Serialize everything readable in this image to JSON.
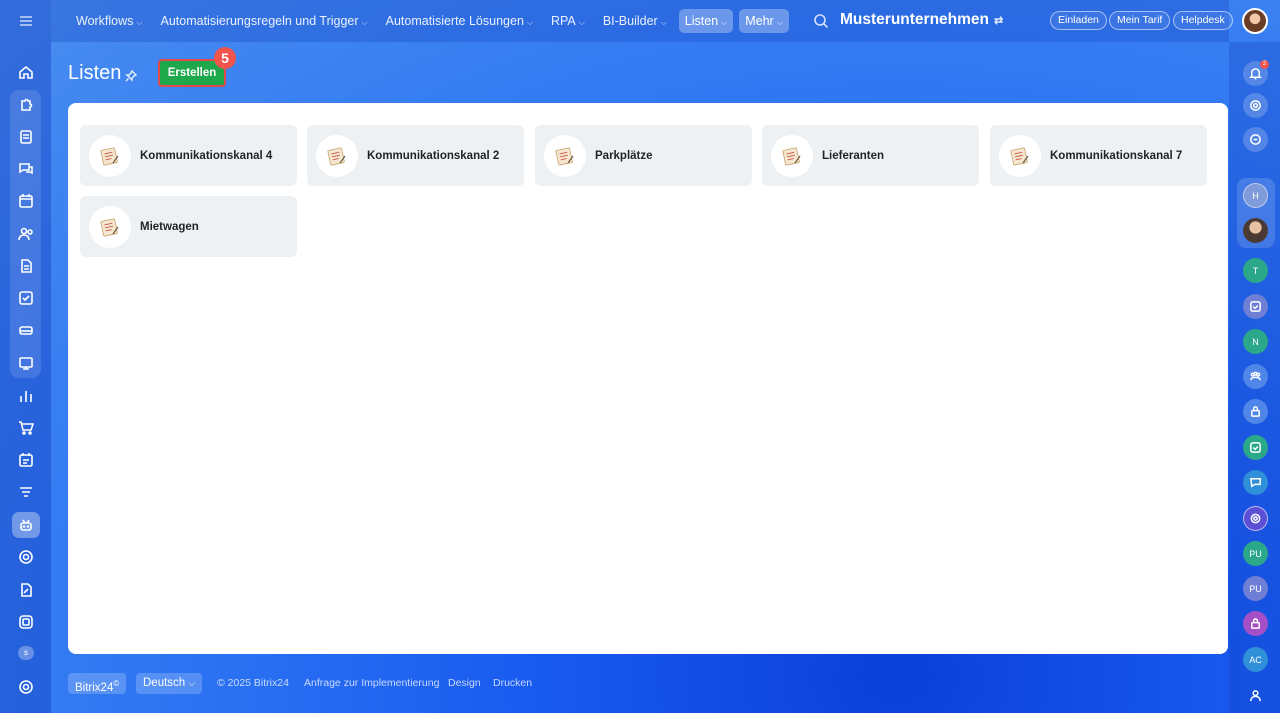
{
  "top_nav": {
    "items": [
      {
        "label": "Workflows",
        "chevron": "⌵"
      },
      {
        "label": "Automatisierungsregeln und Trigger",
        "chevron": "⌵"
      },
      {
        "label": "Automatisierte Lösungen",
        "chevron": "⌵"
      },
      {
        "label": "RPA",
        "chevron": "⌵"
      },
      {
        "label": "BI-Builder",
        "chevron": "⌵"
      },
      {
        "label": "Listen",
        "chevron": "⌵"
      },
      {
        "label": "Mehr",
        "chevron": "⌵"
      }
    ],
    "company": "Musterunternehmen",
    "company_icon": "⇄",
    "invite": "Einladen",
    "tariff": "Mein Tarif",
    "helpdesk": "Helpdesk"
  },
  "page": {
    "title": "Listen",
    "create_button": "Erstellen",
    "step_badge": "5"
  },
  "lists": [
    {
      "label": "Kommunikationskanal 4",
      "icon": "list-icon"
    },
    {
      "label": "Kommunikationskanal 2",
      "icon": "list-icon"
    },
    {
      "label": "Parkplätze",
      "icon": "list-icon"
    },
    {
      "label": "Lieferanten",
      "icon": "list-icon"
    },
    {
      "label": "Kommunikationskanal 7",
      "icon": "list-icon"
    },
    {
      "label": "Mietwagen",
      "icon": "list-icon"
    }
  ],
  "footer": {
    "brand": "Bitrix24",
    "brand_mark": "©",
    "language": "Deutsch",
    "language_chevron": "⌵",
    "copyright": "© 2025 Bitrix24",
    "implementation": "Anfrage zur Implementierung",
    "design": "Design",
    "print": "Drucken"
  },
  "left_sidebar": {
    "user_badge": "s"
  },
  "right_sidebar": {
    "notification_count": "2",
    "chats": [
      {
        "initials": "H",
        "color": "#7f9bd9"
      },
      {
        "initials": "T",
        "color": "#2aa889"
      },
      {
        "initials": "N",
        "color": "#2aa889"
      },
      {
        "initials": "PU",
        "color": "#2aa889"
      },
      {
        "initials": "PU",
        "color": "#6f7fd6"
      },
      {
        "initials": "AC",
        "color": "#2f8fd8"
      }
    ]
  },
  "colors": {
    "create_button": "#1fa74c",
    "step_badge": "#f0544d"
  }
}
